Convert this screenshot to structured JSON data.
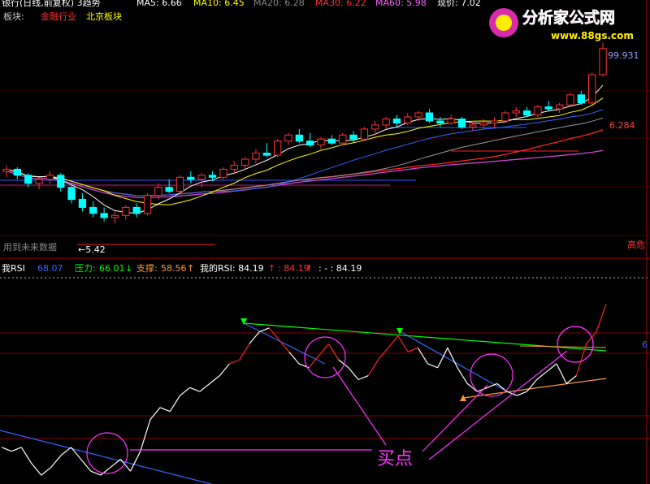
{
  "header": {
    "title": "银行(日线,前复权) 3趋势",
    "ma": [
      {
        "label": "MA5: 6.66",
        "color": "#ffffff"
      },
      {
        "label": "MA10: 6.45",
        "color": "#ffff00"
      },
      {
        "label": "MA20: 6.28",
        "color": "#ff00ff"
      },
      {
        "label": "MA30: 6.22",
        "color": "#00ff00"
      },
      {
        "label": "MA60: 5.98",
        "color": "#ff00ff"
      }
    ],
    "price": "现价: 7.02"
  },
  "sector": {
    "label": "板块:",
    "industry": "金融行业",
    "region": "北京板块"
  },
  "watermark": {
    "name": "分析家公式网",
    "url": "www.88gs.com"
  },
  "price_panel": {
    "price_labels": {
      "top": "99.931",
      "mid": "6.284",
      "low": "←5.42"
    },
    "note": "用到未来数据",
    "risk": "高危",
    "colors": {
      "up": "#ff3333",
      "down": "#00ffff",
      "ma5": "#ffffff",
      "ma10": "#ffff00",
      "ma20": "#3366ff",
      "ma30": "#999999",
      "ma60": "#ff2222",
      "ma120": "#cc44cc",
      "hline": "#3355ff"
    }
  },
  "rsi_header": {
    "name": "我RSI",
    "value": "68.07",
    "pressure_label": "压力:",
    "pressure_value": "66.01",
    "support_label": "支撑:",
    "support_value": "58.56",
    "my_rsi_label": "我的RSI: 84.19",
    "v2": ": 84.19",
    "v3": ": - : 84.19"
  },
  "rsi_panel": {
    "annotation": "买点",
    "right_tick": "6",
    "colors": {
      "rsi": "#ffffff",
      "rsi_hot": "#ff2222",
      "pressure": "#00ff00",
      "trend": "#3366ff",
      "support": "#ff9933",
      "circle": "#ff33ff",
      "arrow_up": "#ff9933",
      "arrow_down": "#00ff00"
    }
  },
  "chart_data": [
    {
      "type": "candlestick",
      "title": "银行(日线,前复权) 3趋势",
      "xlabel": "",
      "ylabel": "",
      "ylim": [
        5.2,
        7.3
      ],
      "grid": false,
      "candles": [
        [
          5.92,
          5.98,
          5.86,
          5.94
        ],
        [
          5.94,
          5.96,
          5.84,
          5.88
        ],
        [
          5.88,
          5.9,
          5.76,
          5.8
        ],
        [
          5.8,
          5.86,
          5.74,
          5.84
        ],
        [
          5.84,
          5.92,
          5.8,
          5.88
        ],
        [
          5.88,
          5.9,
          5.72,
          5.76
        ],
        [
          5.76,
          5.8,
          5.6,
          5.64
        ],
        [
          5.64,
          5.7,
          5.52,
          5.56
        ],
        [
          5.56,
          5.62,
          5.46,
          5.5
        ],
        [
          5.5,
          5.56,
          5.42,
          5.46
        ],
        [
          5.46,
          5.52,
          5.4,
          5.48
        ],
        [
          5.48,
          5.58,
          5.44,
          5.56
        ],
        [
          5.56,
          5.6,
          5.46,
          5.5
        ],
        [
          5.5,
          5.7,
          5.48,
          5.68
        ],
        [
          5.68,
          5.8,
          5.64,
          5.76
        ],
        [
          5.76,
          5.84,
          5.7,
          5.72
        ],
        [
          5.72,
          5.88,
          5.7,
          5.86
        ],
        [
          5.86,
          5.92,
          5.8,
          5.84
        ],
        [
          5.84,
          5.9,
          5.76,
          5.88
        ],
        [
          5.88,
          5.92,
          5.82,
          5.86
        ],
        [
          5.86,
          5.96,
          5.84,
          5.94
        ],
        [
          5.94,
          6.02,
          5.9,
          5.98
        ],
        [
          5.98,
          6.06,
          5.94,
          6.04
        ],
        [
          6.04,
          6.14,
          6.0,
          6.1
        ],
        [
          6.1,
          6.2,
          6.06,
          6.08
        ],
        [
          6.08,
          6.24,
          6.06,
          6.22
        ],
        [
          6.22,
          6.3,
          6.18,
          6.28
        ],
        [
          6.28,
          6.34,
          6.2,
          6.22
        ],
        [
          6.22,
          6.3,
          6.16,
          6.18
        ],
        [
          6.18,
          6.26,
          6.14,
          6.24
        ],
        [
          6.24,
          6.28,
          6.18,
          6.2
        ],
        [
          6.2,
          6.3,
          6.18,
          6.28
        ],
        [
          6.28,
          6.32,
          6.2,
          6.24
        ],
        [
          6.24,
          6.36,
          6.22,
          6.34
        ],
        [
          6.34,
          6.42,
          6.28,
          6.38
        ],
        [
          6.38,
          6.46,
          6.34,
          6.44
        ],
        [
          6.44,
          6.48,
          6.36,
          6.4
        ],
        [
          6.4,
          6.5,
          6.38,
          6.46
        ],
        [
          6.46,
          6.52,
          6.42,
          6.5
        ],
        [
          6.5,
          6.54,
          6.4,
          6.42
        ],
        [
          6.42,
          6.46,
          6.36,
          6.4
        ],
        [
          6.4,
          6.48,
          6.38,
          6.44
        ],
        [
          6.44,
          6.46,
          6.34,
          6.36
        ],
        [
          6.36,
          6.42,
          6.32,
          6.38
        ],
        [
          6.38,
          6.44,
          6.34,
          6.4
        ],
        [
          6.4,
          6.46,
          6.36,
          6.42
        ],
        [
          6.42,
          6.52,
          6.4,
          6.5
        ],
        [
          6.5,
          6.56,
          6.46,
          6.52
        ],
        [
          6.52,
          6.56,
          6.46,
          6.48
        ],
        [
          6.48,
          6.58,
          6.46,
          6.56
        ],
        [
          6.56,
          6.62,
          6.52,
          6.54
        ],
        [
          6.54,
          6.6,
          6.5,
          6.58
        ],
        [
          6.58,
          6.7,
          6.56,
          6.68
        ],
        [
          6.68,
          6.72,
          6.58,
          6.6
        ],
        [
          6.6,
          6.9,
          6.58,
          6.88
        ],
        [
          6.88,
          7.2,
          6.86,
          7.14
        ]
      ]
    },
    {
      "type": "line",
      "title": "我RSI",
      "xlabel": "",
      "ylabel": "",
      "ylim": [
        40,
        90
      ],
      "grid": false,
      "series": [
        {
          "name": "我RSI",
          "values": [
            48,
            47,
            48,
            44,
            41,
            43,
            46,
            48,
            45,
            42,
            41,
            43,
            45,
            42,
            47,
            55,
            58,
            57,
            61,
            63,
            62,
            64,
            66,
            69,
            70,
            74,
            77,
            78,
            75,
            72,
            69,
            68,
            71,
            74,
            70,
            68,
            65,
            66,
            70,
            73,
            76,
            72,
            73,
            69,
            68,
            73,
            68,
            64,
            62,
            63,
            64,
            62,
            61,
            62,
            65,
            67,
            69,
            64,
            66,
            74,
            77,
            84
          ]
        }
      ]
    }
  ]
}
